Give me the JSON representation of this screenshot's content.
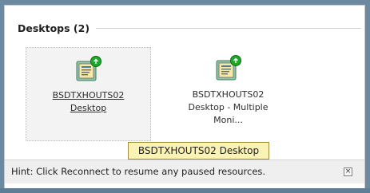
{
  "section": {
    "title": "Desktops (2)"
  },
  "desktops": [
    {
      "line1": "BSDTXHOUTS02",
      "line2": "Desktop",
      "line3": "",
      "icon": "desktop-icon",
      "selected": true
    },
    {
      "line1": "BSDTXHOUTS02",
      "line2": "Desktop - Multiple",
      "line3": "Moni...",
      "icon": "desktop-icon",
      "selected": false
    }
  ],
  "tooltip": {
    "text": "BSDTXHOUTS02 Desktop"
  },
  "hint": {
    "text": "Hint: Click Reconnect to resume any paused resources.",
    "close_label": "×"
  },
  "colors": {
    "tooltip_bg": "#fbf3b4",
    "badge": "#1ea82a",
    "icon_base": "#8ec5a8"
  }
}
